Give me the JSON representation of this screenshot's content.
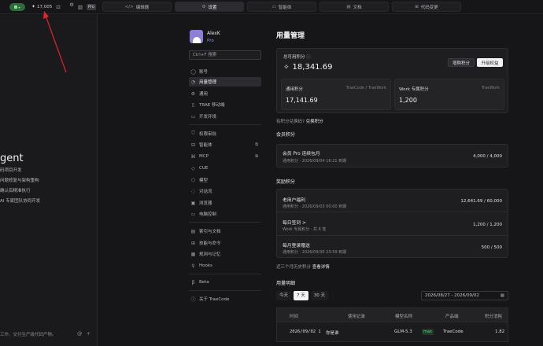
{
  "topbar": {
    "credits_value": "17,005",
    "pro_label": "Pro",
    "tabs": [
      {
        "label": "编辑器",
        "icon": "code-icon"
      },
      {
        "label": "设置",
        "icon": "gear-icon"
      },
      {
        "label": "智能体",
        "icon": "folder-icon"
      },
      {
        "label": "文档",
        "icon": "document-icon"
      },
      {
        "label": "代码变更",
        "icon": "diff-icon"
      }
    ]
  },
  "left_panel": {
    "title": "gent",
    "lines": [
      "码项目开发",
      "问题修复与架构重构",
      "确认后精准执行",
      "AI 专家团队协同开发"
    ],
    "input_hint": "工作、交付生产级代码产物。"
  },
  "user": {
    "name": "AlexK",
    "plan": "Pro"
  },
  "sidebar": {
    "search_placeholder": "Ctrl+F 搜索",
    "items": [
      {
        "label": "账号",
        "icon": "user-icon"
      },
      {
        "label": "用量管理",
        "icon": "gauge-icon"
      },
      {
        "label": "通用",
        "icon": "settings-icon"
      },
      {
        "label": "TRAE 移动端",
        "icon": "phone-icon"
      },
      {
        "label": "开发环境",
        "icon": "terminal-icon"
      },
      {
        "label": "权限审批",
        "icon": "shield-icon"
      },
      {
        "label": "智能体",
        "icon": "agent-icon"
      },
      {
        "label": "MCP",
        "icon": "mcp-icon"
      },
      {
        "label": "CUE",
        "icon": "cue-icon"
      },
      {
        "label": "模型",
        "icon": "cube-icon"
      },
      {
        "label": "对话流",
        "icon": "chat-icon"
      },
      {
        "label": "浏览器",
        "icon": "browser-icon"
      },
      {
        "label": "电脑控制",
        "icon": "monitor-icon"
      },
      {
        "label": "索引与文档",
        "icon": "index-icon"
      },
      {
        "label": "技能与命令",
        "icon": "skill-icon"
      },
      {
        "label": "规则与记忆",
        "icon": "rule-icon"
      },
      {
        "label": "Hooks",
        "icon": "hook-icon"
      },
      {
        "label": "Beta",
        "icon": "beta-icon"
      },
      {
        "label": "关于 TraeCode",
        "icon": "info-icon"
      }
    ]
  },
  "usage": {
    "title": "用量管理",
    "total_label": "总可用积分",
    "total_value": "18,341.69",
    "buy_button": "增购积分",
    "upgrade_button": "升级权益",
    "general_label": "通用积分",
    "general_scope": "TraeCode / TraeWork",
    "general_value": "17,141.69",
    "work_label": "Work 专属积分",
    "work_scope": "TraeWork",
    "work_value": "1,200",
    "exchange_question": "有积分兑换码?",
    "exchange_link": "兑换积分"
  },
  "member_section": {
    "title": "会员积分",
    "row_title": "会员 Pro 连续包月",
    "row_sub": "通用积分 · 2026/09/04 16:21 到期",
    "row_value": "4,000 / 4,000"
  },
  "reward_section": {
    "title": "奖励积分",
    "rows": [
      {
        "title": "老用户福利",
        "sub": "通用积分 · 2026/09/03 00:00 到期",
        "value": "12,641.69 / 60,000"
      },
      {
        "title": "每日签到 >",
        "sub": "Work 专属积分 · 共 6 笔",
        "value": "1,200 / 1,200"
      },
      {
        "title": "每月登录赠送",
        "sub": "通用积分 · 2026/09/30 23:59 到期",
        "value": "500 / 500"
      }
    ],
    "history_text": "近三个月历史积分",
    "history_link": "查看详情"
  },
  "detail_section": {
    "title": "用量明细",
    "ranges": [
      "今天",
      "7 天",
      "30 天"
    ],
    "date_range": "2026/08/27 - 2026/09/02",
    "columns": [
      "时间",
      "使用记录",
      "模型名称",
      "产品端",
      "积分消耗"
    ],
    "row": {
      "time": "2026/09/02 1",
      "record": "你是谁",
      "model": "GLM-5.3",
      "tag": "max",
      "product": "TraeCode",
      "cost": "1.82"
    }
  }
}
